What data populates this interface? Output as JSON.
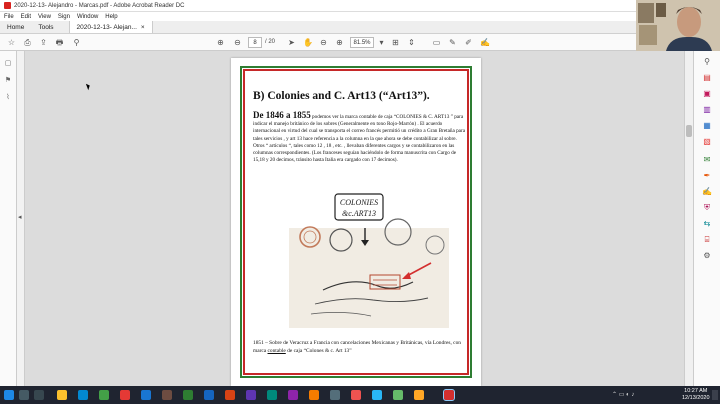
{
  "window": {
    "title": "2020-12-13- Alejandro - Marcas.pdf - Adobe Acrobat Reader DC"
  },
  "menu": [
    "File",
    "Edit",
    "View",
    "Sign",
    "Window",
    "Help"
  ],
  "tabs": {
    "home": "Home",
    "tools": "Tools",
    "document": "2020-12-13- Alejan...",
    "close": "×"
  },
  "toolbar": {
    "page_current": "8",
    "page_total": "/ 20",
    "zoom": "81.5%"
  },
  "document": {
    "heading": "B) Colonies and C. Art13 (“Art13”).",
    "lead": "De 1846 a 1855",
    "paragraph": " podemos ver la marca contable de caja “COLONIES & C. ART13 ” para indicar el manejo británico de los sobres (Generalmente en tono Rojo-Marrón) . El acuerdo internacional en virtud del cual se transporta el correo francés permitió un crédito a Gran Bretaña para tales servicios , y art 13 hace referencia a la columna en la que ahora se debe contabilizar al sobre. Otros “ artículos “, tales como 12 , 18 , etc. , llevaban diferentes cargos y se contabilizaron en las columnas correspondientes. (Los franceses seguían haciéndolo de forma manuscrita con Cargo de 15,18 y 20 decimos, tránsito hasta Italia era cargado con 17 decimos).",
    "stamp_line1": "COLONIES",
    "stamp_line2": "&c.ART13",
    "caption_a": "1851 – Sobre de Veracruz a Francia con cancelaciones Mexicanas y Británicas, vía Londres, con marca ",
    "caption_b": "contable",
    "caption_c": " de caja “Colones & c. Art 13”"
  },
  "taskbar": {
    "time": "10:27 AM",
    "date": "12/13/2020"
  },
  "colors": {
    "frame_green": "#2e7d32",
    "frame_red": "#c62828",
    "stamp_red": "#b5482f",
    "arrow_red": "#d32f2f"
  }
}
